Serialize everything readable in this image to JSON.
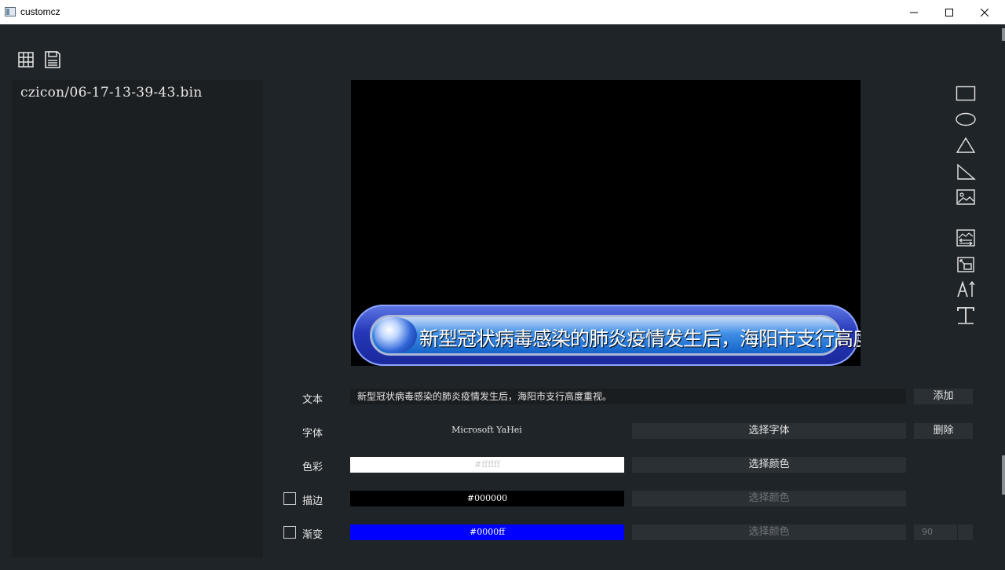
{
  "window": {
    "title": "customcz"
  },
  "file_list": {
    "items": [
      "czicon/06-17-13-39-43.bin"
    ]
  },
  "canvas": {
    "banner_text": "新型冠状病毒感染的肺炎疫情发生后，海阳市支行高度重视。"
  },
  "form": {
    "text_label": "文本",
    "text_value": "新型冠状病毒感染的肺炎疫情发生后，海阳市支行高度重视。",
    "add_button": "添加",
    "font_label": "字体",
    "font_value": "Microsoft YaHei",
    "choose_font_button": "选择字体",
    "delete_button": "删除",
    "color_label": "色彩",
    "color_value": "#ffffff",
    "choose_color_button": "选择颜色",
    "stroke_label": "描边",
    "stroke_value": "#000000",
    "stroke_choose_color_button": "选择颜色",
    "gradient_label": "渐变",
    "gradient_value": "#0000ff",
    "gradient_choose_color_button": "选择颜色",
    "gradient_angle": "90"
  },
  "colors": {
    "background": "#1f2428",
    "panel": "#1b1f22",
    "button": "#2b3034",
    "fill_color": "#ffffff",
    "stroke_color": "#000000",
    "gradient_color": "#0000ff"
  },
  "icons": {
    "toolbar": [
      "grid-icon",
      "save-icon"
    ],
    "shape_tools": [
      "rectangle-icon",
      "ellipse-icon",
      "triangle-icon",
      "right-triangle-icon",
      "image-icon",
      "image-slideshow-icon",
      "image-layer-icon",
      "vertical-text-icon",
      "text-icon"
    ]
  }
}
